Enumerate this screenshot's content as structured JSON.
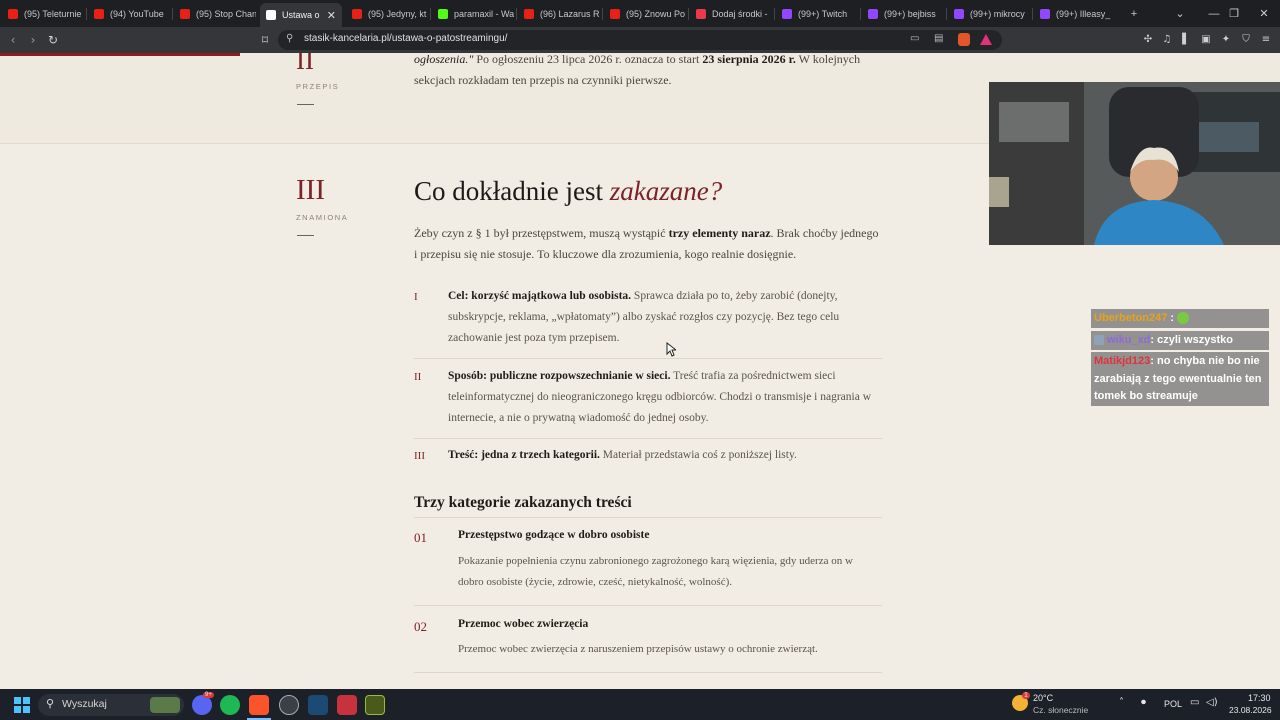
{
  "browser": {
    "tabs": [
      {
        "label": "(95) Teleturnie",
        "icon": "youtube-icon",
        "color": "#e62117"
      },
      {
        "label": "(94) YouTube",
        "icon": "youtube-icon",
        "color": "#e62117"
      },
      {
        "label": "(95) Stop Chan",
        "icon": "youtube-icon",
        "color": "#e62117"
      },
      {
        "label": "Ustawa o",
        "icon": "page-icon",
        "color": "#ffffff",
        "active": true
      },
      {
        "label": "(95) Jedyny, kt",
        "icon": "youtube-icon",
        "color": "#e62117"
      },
      {
        "label": "paramaxil - Wa",
        "icon": "kick-icon",
        "color": "#53fc18"
      },
      {
        "label": "(96) Lazarus Ru",
        "icon": "youtube-icon",
        "color": "#e62117"
      },
      {
        "label": "(95) Znowu Po",
        "icon": "youtube-icon",
        "color": "#e62117"
      },
      {
        "label": "Dodaj środki -",
        "icon": "bookmark-icon",
        "color": "#e83a4a"
      },
      {
        "label": "(99+) Twitch",
        "icon": "twitch-icon",
        "color": "#9147ff"
      },
      {
        "label": "(99+) bejbiss",
        "icon": "twitch-icon",
        "color": "#9147ff"
      },
      {
        "label": "(99+) mikrocy",
        "icon": "twitch-icon",
        "color": "#9147ff"
      },
      {
        "label": "(99+) Illeasy_",
        "icon": "twitch-icon",
        "color": "#9147ff"
      }
    ],
    "new_tab": "+",
    "url": "stasik-kancelaria.pl/ustawa-o-patostreamingu/"
  },
  "page": {
    "prev_section": {
      "roman": "II",
      "label": "PRZEPIS",
      "text_italic": "ogłoszenia.\"",
      "text_1": " Po ogłoszeniu 23 lipca 2026 r. oznacza to start ",
      "text_bold": "23 sierpnia 2026 r.",
      "text_2": " W kolejnych sekcjach rozkładam ten przepis na czynniki pierwsze."
    },
    "section": {
      "roman": "III",
      "label": "ZNAMIONA",
      "heading_plain": "Co dokładnie jest ",
      "heading_em": "zakazane?",
      "intro_1": "Żeby czyn z § 1 był przestępstwem, muszą wystąpić ",
      "intro_bold": "trzy elementy naraz",
      "intro_2": ". Brak choćby jednego i przepisu się nie stosuje. To kluczowe dla zrozumienia, kogo realnie dosięgnie.",
      "elements": [
        {
          "num": "I",
          "title": "Cel: korzyść majątkowa lub osobista.",
          "text": " Sprawca działa po to, żeby zarobić (donejty, subskrypcje, reklama, „wpłatomaty”) albo zyskać rozgłos czy pozycję. Bez tego celu zachowanie jest poza tym przepisem."
        },
        {
          "num": "II",
          "title": "Sposób: publiczne rozpowszechnianie w sieci.",
          "text": " Treść trafia za pośrednictwem sieci teleinformatycznej do nieograniczonego kręgu odbiorców. Chodzi o transmisje i nagrania w internecie, a nie o prywatną wiadomość do jednej osoby."
        },
        {
          "num": "III",
          "title": "Treść: jedna z trzech kategorii.",
          "text": " Materiał przedstawia coś z poniższej listy."
        }
      ],
      "subheading": "Trzy kategorie zakazanych treści",
      "categories": [
        {
          "num": "01",
          "title": "Przestępstwo godzące w dobro osobiste",
          "text": "Pokazanie popełnienia czynu zabronionego zagrożonego karą więzienia, gdy uderza on w dobro osobiste (życie, zdrowie, cześć, nietykalność, wolność)."
        },
        {
          "num": "02",
          "title": "Przemoc wobec zwierzęcia",
          "text": "Przemoc wobec zwierzęcia z naruszeniem przepisów ustawy o ochronie zwierząt."
        }
      ]
    }
  },
  "chat": [
    {
      "user": "Uberbeton247",
      "user_color": "#e8a21a",
      "message": " : ",
      "emote": "green-face-emote"
    },
    {
      "user": "wiku_xd",
      "user_color": "#8e6ad8",
      "message": ": czyli wszystko",
      "badge": "badge-icon"
    },
    {
      "user": "Matikjd123",
      "user_color": "#e0323c",
      "message": ": no chyba nie bo nie zarabiają z tego ewentualnie ten tomek bo streamuje"
    }
  ],
  "taskbar": {
    "search_placeholder": "Wyszukaj",
    "weather_temp": "20°C",
    "weather_desc": "Cz. słonecznie",
    "weather_badge": "1",
    "lang": "POL",
    "time": "17:30",
    "date": "23.08.2026",
    "apps": [
      "windows-start-icon",
      "discord-icon",
      "spotify-icon",
      "brave-icon",
      "obs-icon",
      "steam-icon",
      "app-icon",
      "wsl-icon"
    ],
    "discord_badge": "9+"
  },
  "colors": {
    "accent": "#7d2226",
    "page_bg": "#f1ede4",
    "browser_dark": "#35363a"
  }
}
